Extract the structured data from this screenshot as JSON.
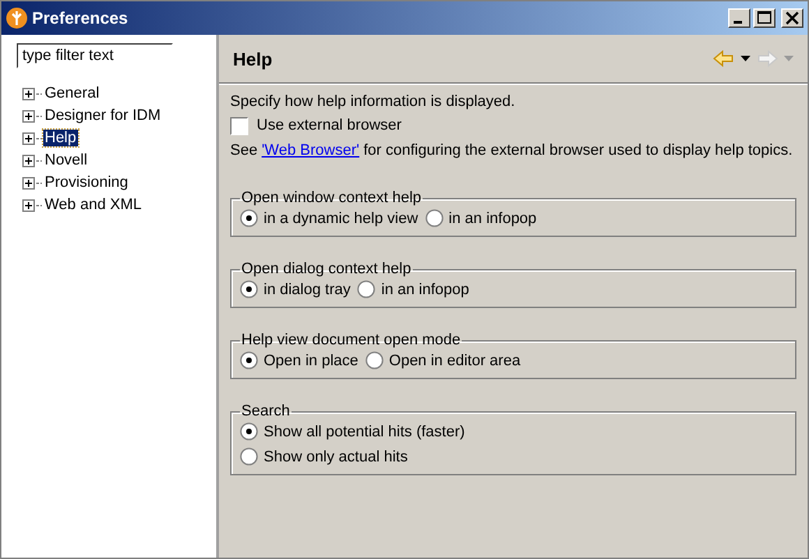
{
  "window": {
    "title": "Preferences"
  },
  "filter": {
    "placeholder": "type filter text"
  },
  "tree": [
    {
      "label": "General",
      "selected": false
    },
    {
      "label": "Designer for IDM",
      "selected": false
    },
    {
      "label": "Help",
      "selected": true
    },
    {
      "label": "Novell",
      "selected": false
    },
    {
      "label": "Provisioning",
      "selected": false
    },
    {
      "label": "Web and XML",
      "selected": false
    }
  ],
  "page": {
    "title": "Help",
    "description": "Specify how help information is displayed.",
    "external_browser": {
      "label": "Use external browser",
      "checked": false
    },
    "see_text": {
      "before": "See",
      "link": "'Web Browser'",
      "after": "for configuring the external browser used to display help topics."
    },
    "groups": [
      {
        "title": "Open window context help",
        "kind": "inline",
        "options": [
          {
            "label": "in a dynamic help view",
            "selected": true
          },
          {
            "label": "in an infopop",
            "selected": false
          }
        ]
      },
      {
        "title": "Open dialog context help",
        "kind": "inline",
        "options": [
          {
            "label": "in dialog tray",
            "selected": true
          },
          {
            "label": "in an infopop",
            "selected": false
          }
        ]
      },
      {
        "title": "Help view document open mode",
        "kind": "inline",
        "options": [
          {
            "label": "Open in place",
            "selected": true
          },
          {
            "label": "Open in editor area",
            "selected": false
          }
        ]
      },
      {
        "title": "Search",
        "kind": "stacked",
        "options": [
          {
            "label": "Show all potential hits (faster)",
            "selected": true
          },
          {
            "label": "Show only actual hits",
            "selected": false
          }
        ]
      }
    ]
  }
}
